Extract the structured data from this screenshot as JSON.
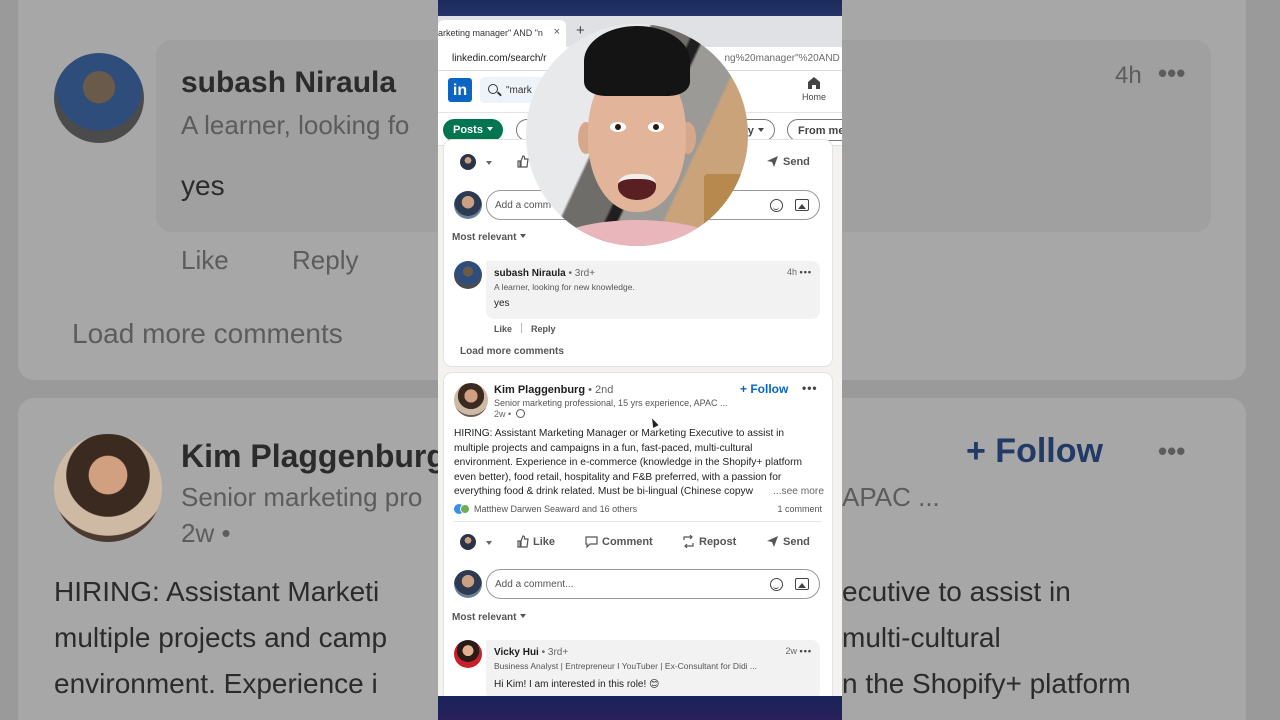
{
  "browser": {
    "tab_title": "arketing manager\" AND \"n",
    "tab_close": "×",
    "tab_new": "+",
    "url_host": "linkedin.com/search/r",
    "url_tail": "ng%20manager\"%20AND"
  },
  "linkedin_header": {
    "logo": "in",
    "search_value": "\"mark",
    "home_label": "Home"
  },
  "filters": {
    "posts_label": "Posts",
    "by_label": "oy",
    "from_label": "From me"
  },
  "actions": {
    "like": "Like",
    "comment": "Comment",
    "repost": "Repost",
    "send": "Send"
  },
  "comment_box": {
    "placeholder_1": "Add a comm",
    "placeholder_2": "Add a comment..."
  },
  "most_relevant": "Most relevant",
  "comment_1": {
    "name": "subash Niraula",
    "degree": "• 3rd+",
    "headline": "A learner, looking for new knowledge.",
    "time": "4h",
    "text": "yes",
    "like": "Like",
    "reply": "Reply"
  },
  "load_more": "Load more comments",
  "post": {
    "author": "Kim Plaggenburg",
    "degree": "• 2nd",
    "headline": "Senior marketing professional, 15 yrs experience, APAC ...",
    "meta": "2w •",
    "follow": "+ Follow",
    "body_lines": [
      "HIRING: Assistant Marketing Manager or Marketing Executive to assist in",
      "multiple projects and campaigns in a fun, fast-paced, multi-cultural",
      "environment. Experience in e-commerce (knowledge in the Shopify+ platform",
      "even better), food retail, hospitality and F&B preferred, with a passion for",
      "everything food & drink related. Must be bi-lingual (Chinese copyw"
    ],
    "see_more": "...see more",
    "reactions": "Matthew Darwen Seaward and 16 others",
    "comment_count": "1 comment"
  },
  "comment_2": {
    "name": "Vicky Hui",
    "degree": "• 3rd+",
    "headline": "Business Analyst | Entrepreneur I YouTuber | Ex-Consultant for Didi ...",
    "time": "2w",
    "text": "Hi Kim! I am interested in this role! 😊"
  },
  "background_zoom": {
    "name": "subash Niraula",
    "headline": "A learner, looking fo",
    "time": "4h",
    "text": "yes",
    "like": "Like",
    "reply": "Reply",
    "load_more": "Load more comments",
    "author": "Kim Plaggenburg",
    "author_headline": "Senior marketing pro",
    "headline_tail": "APAC ...",
    "meta": "2w •",
    "follow": "+ Follow",
    "body_left": [
      "HIRING: Assistant Marketi",
      "multiple projects and camp",
      "environment. Experience i"
    ],
    "body_right": [
      "ecutive to assist in",
      "multi-cultural",
      "n the Shopify+ platform"
    ]
  },
  "colors": {
    "linkedin_blue": "#0a66c2",
    "posts_green": "#01754f"
  }
}
